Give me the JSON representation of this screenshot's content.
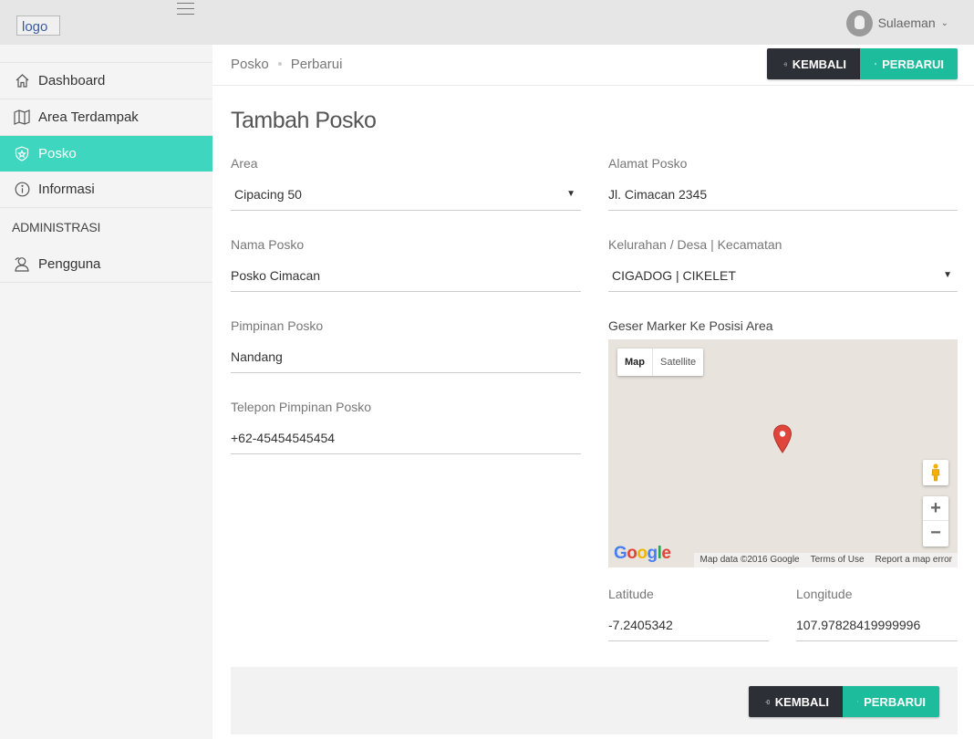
{
  "topbar": {
    "logo_alt": "logo",
    "user_name": "Sulaeman"
  },
  "sidebar": {
    "items": [
      {
        "label": "Dashboard",
        "icon": "home-icon"
      },
      {
        "label": "Area Terdampak",
        "icon": "map-icon"
      },
      {
        "label": "Posko",
        "icon": "shield-icon",
        "active": true
      },
      {
        "label": "Informasi",
        "icon": "info-icon"
      }
    ],
    "section_heading": "ADMINISTRASI",
    "admin_items": [
      {
        "label": "Pengguna",
        "icon": "users-icon"
      }
    ],
    "active_color": "#3fd6c0"
  },
  "breadcrumb": {
    "items": [
      "Posko",
      "Perbarui"
    ]
  },
  "buttons": {
    "back_label": "KEMBALI",
    "update_label": "PERBARUI",
    "back_color": "#2c3036",
    "update_color": "#1cbc9c"
  },
  "form": {
    "title": "Tambah Posko",
    "area": {
      "label": "Area",
      "value": "Cipacing 50"
    },
    "nama": {
      "label": "Nama Posko",
      "value": "Posko Cimacan"
    },
    "pimpinan": {
      "label": "Pimpinan Posko",
      "value": "Nandang"
    },
    "telepon": {
      "label": "Telepon Pimpinan Posko",
      "value": "+62-45454545454"
    },
    "alamat": {
      "label": "Alamat Posko",
      "value": "Jl. Cimacan 2345"
    },
    "kelurahan": {
      "label": "Kelurahan / Desa | Kecamatan",
      "value": "CIGADOG | CIKELET"
    },
    "map_label": "Geser Marker Ke Posisi Area",
    "latitude": {
      "label": "Latitude",
      "value": "-7.2405342"
    },
    "longitude": {
      "label": "Longitude",
      "value": "107.97828419999996"
    }
  },
  "map": {
    "type_map": "Map",
    "type_satellite": "Satellite",
    "logo": "Google",
    "attribution": "Map data ©2016 Google",
    "terms": "Terms of Use",
    "report": "Report a map error",
    "zoom_in": "+",
    "zoom_out": "−"
  }
}
